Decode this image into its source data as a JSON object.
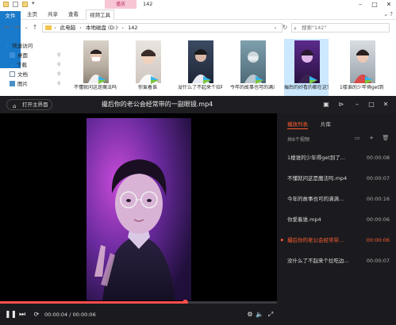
{
  "explorer": {
    "window_title": "142",
    "context_tab": "播放",
    "ribbon_tabs": [
      "文件",
      "主页",
      "共享",
      "查看",
      "视频工具"
    ],
    "breadcrumb": [
      "此电脑",
      "本地磁盘 (D:)",
      "142"
    ],
    "search_placeholder": "搜索\"142\"",
    "nav_pane": [
      {
        "label": "快速访问",
        "icon": "star-icon",
        "color": "#1c7ed6"
      },
      {
        "label": "桌面",
        "icon": "desktop-icon",
        "color": "#3b8ed9"
      },
      {
        "label": "下载",
        "icon": "download-icon",
        "color": "#2f7fcf"
      },
      {
        "label": "文档",
        "icon": "document-icon",
        "color": "#7a8ba8"
      },
      {
        "label": "图片",
        "icon": "pictures-icon",
        "color": "#4a90c8"
      }
    ],
    "files": [
      {
        "name": "不懂就问这是魔法吗"
      },
      {
        "name": "你爱着谁"
      },
      {
        "name": "没什么了不起来个拉吃边"
      },
      {
        "name": "今年的故事也可的满满"
      },
      {
        "name": "撮后的好看的都在这常常"
      },
      {
        "name": "1楼谁的少年得get到了"
      }
    ]
  },
  "player": {
    "home_button": "打开主界面",
    "title": "撮后你的老公会经常带的一副眼镜.mp4",
    "tabs": [
      "播放列表",
      "片库"
    ],
    "count_label": "共6个视频",
    "playlist": [
      {
        "name": "1楼谁的少年得get到了...",
        "duration": "00:00:08",
        "playing": false
      },
      {
        "name": "不懂就问这是魔法吗.mp4",
        "duration": "00:00:07",
        "playing": false
      },
      {
        "name": "今年的故事也可的满满...",
        "duration": "00:00:16",
        "playing": false
      },
      {
        "name": "你爱着谁.mp4",
        "duration": "00:00:06",
        "playing": false
      },
      {
        "name": "撮后你的老公会经常带...",
        "duration": "00:00:06",
        "playing": true
      },
      {
        "name": "没什么了不起来个拉吃边...",
        "duration": "00:00:07",
        "playing": false
      }
    ],
    "time_display": "00:00:04 / 00:00:06",
    "progress_fraction": 0.667,
    "accent_color": "#ff5d2e"
  }
}
